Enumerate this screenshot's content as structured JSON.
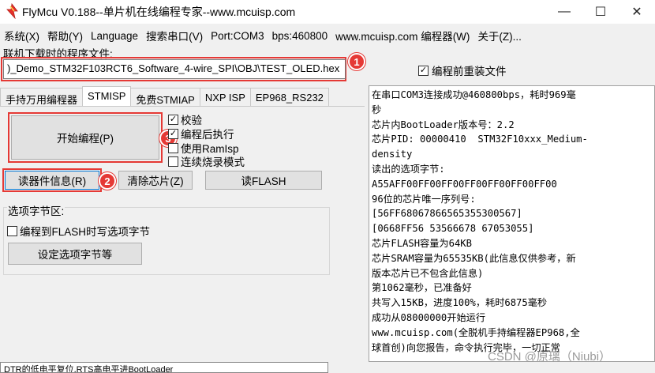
{
  "window": {
    "title": "FlyMcu V0.188--单片机在线编程专家--www.mcuisp.com",
    "minimize": "—",
    "maximize": "☐",
    "close": "✕"
  },
  "menu": [
    "系统(X)",
    "帮助(Y)",
    "Language",
    "搜索串口(V)",
    "Port:COM3",
    "bps:460800",
    "www.mcuisp.com 编程器(W)",
    "关于(Z)..."
  ],
  "file": {
    "label": "联机下载时的程序文件:",
    "path": ")_Demo_STM32F103RCT6_Software_4-wire_SPI\\OBJ\\TEST_OLED.hex",
    "browse": "...",
    "reload_label": "编程前重装文件",
    "reload_checked": true
  },
  "tabs": [
    "手持万用编程器",
    "STMISP",
    "免费STMIAP",
    "NXP ISP",
    "EP968_RS232"
  ],
  "active_tab": "STMISP",
  "stmisp": {
    "start_button": "开始编程(P)",
    "options": [
      {
        "label": "校验",
        "checked": true
      },
      {
        "label": "编程后执行",
        "checked": true
      },
      {
        "label": "使用RamIsp",
        "checked": false
      },
      {
        "label": "连续烧录模式",
        "checked": false
      }
    ],
    "read_info_button": "读器件信息(R)",
    "erase_button": "清除芯片(Z)",
    "read_flash_button": "读FLASH",
    "option_bytes": {
      "title": "选项字节区:",
      "write_option_label": "编程到FLASH时写选项字节",
      "write_option_checked": false,
      "set_button": "设定选项字节等"
    }
  },
  "annotations": [
    "1",
    "2",
    "3"
  ],
  "log": [
    "在串口COM3连接成功@460800bps，耗时969毫",
    "秒",
    "芯片内BootLoader版本号：2.2",
    "芯片PID: 00000410  STM32F10xxx_Medium-",
    "density",
    "读出的选项字节:",
    "A55AFF00FF00FF00FF00FF00FF00FF00",
    "96位的芯片唯一序列号:",
    "[56FF68067866565355300567]",
    "[0668FF56 53566678 67053055]",
    "芯片FLASH容量为64KB",
    "芯片SRAM容量为65535KB(此信息仅供参考，新",
    "版本芯片已不包含此信息)",
    "第1062毫秒，已准备好",
    "共写入15KB，进度100%，耗时6875毫秒",
    "成功从08000000开始运行",
    "www.mcuisp.com(全脱机手持编程器EP968,全",
    "球首创)向您报告，命令执行完毕，一切正常"
  ],
  "status_bar": "DTR的低电平复位,RTS高电平进BootLoader",
  "watermark": "CSDN @原璃（Niubi）",
  "colors": {
    "highlight_red": "#e53935",
    "focus_blue": "#0078d7"
  }
}
